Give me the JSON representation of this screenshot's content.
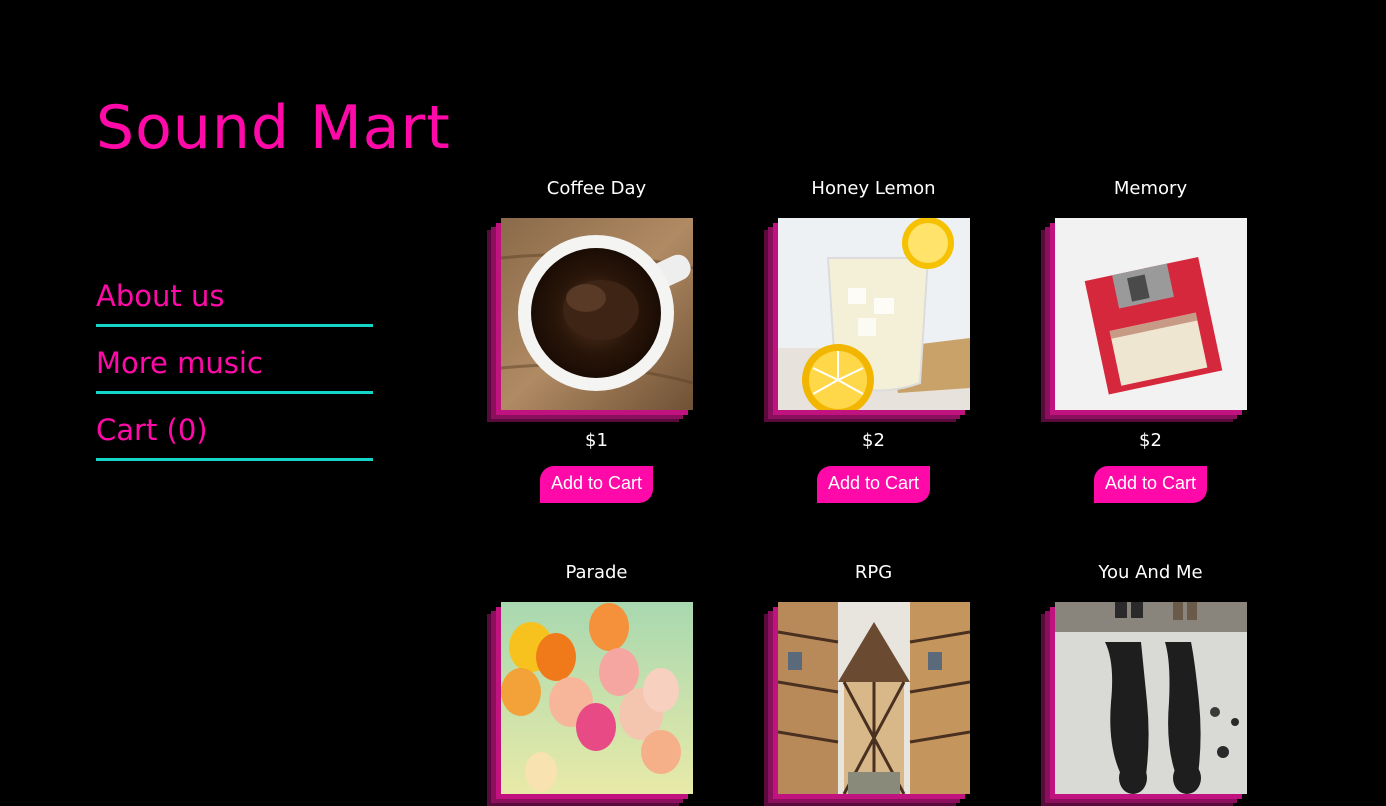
{
  "site": {
    "title": "Sound Mart"
  },
  "nav": {
    "items": [
      {
        "label": "About us"
      },
      {
        "label": "More music"
      },
      {
        "label": "Cart (0)"
      }
    ]
  },
  "products": [
    {
      "title": "Coffee Day",
      "price": "$1",
      "button": "Add to Cart",
      "image": "coffee-cup-image"
    },
    {
      "title": "Honey Lemon",
      "price": "$2",
      "button": "Add to Cart",
      "image": "lemonade-glass-image"
    },
    {
      "title": "Memory",
      "price": "$2",
      "button": "Add to Cart",
      "image": "floppy-disk-image"
    },
    {
      "title": "Parade",
      "price": "",
      "button": "",
      "image": "balloons-image"
    },
    {
      "title": "RPG",
      "price": "",
      "button": "",
      "image": "village-street-image"
    },
    {
      "title": "You And Me",
      "price": "",
      "button": "",
      "image": "couple-reflection-image"
    }
  ],
  "colors": {
    "accent": "#ff0aa8",
    "underline": "#14d6c8",
    "background": "#000000",
    "text": "#ffffff"
  }
}
